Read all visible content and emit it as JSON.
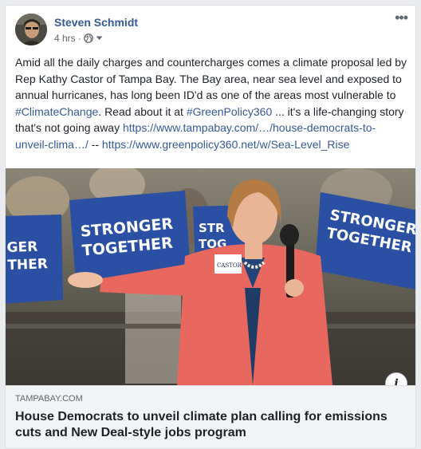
{
  "post": {
    "author": "Steven Schmidt",
    "time": "4 hrs",
    "separator": "·",
    "audience_icon": "globe-icon",
    "menu_icon": "more-options-icon",
    "text": {
      "part1": "Amid all the daily charges and countercharges comes a climate proposal led by Rep Kathy Castor of Tampa Bay. The Bay area, near sea level and exposed to annual hurricanes, has long been ID'd as one of the areas most vulnerable to ",
      "hashtag1": "#ClimateChange",
      "part2": ". Read about it at ",
      "hashtag2": "#GreenPolicy360",
      "part3": " ... it's a life-changing story that's not going away ",
      "link1": "https://www.tampabay.com/…/house-democrats-to-unveil-clima…/",
      "part4": " -- ",
      "link2": "https://www.greenpolicy360.net/w/Sea-Level_Rise"
    }
  },
  "link_preview": {
    "image_signs": [
      "STRONGER TOGETHER",
      "STRONGER TOGETHER",
      "STRONGER TOGETHER",
      "GER THER"
    ],
    "name_tag": "CASTOR",
    "domain": "TAMPABAY.COM",
    "headline": "House Democrats to unveil climate plan calling for emissions cuts and New Deal-style jobs program",
    "info_label": "i"
  },
  "colors": {
    "link": "#365899",
    "author": "#385898",
    "sign_blue": "#2a4fa3",
    "jacket": "#e8685f"
  }
}
